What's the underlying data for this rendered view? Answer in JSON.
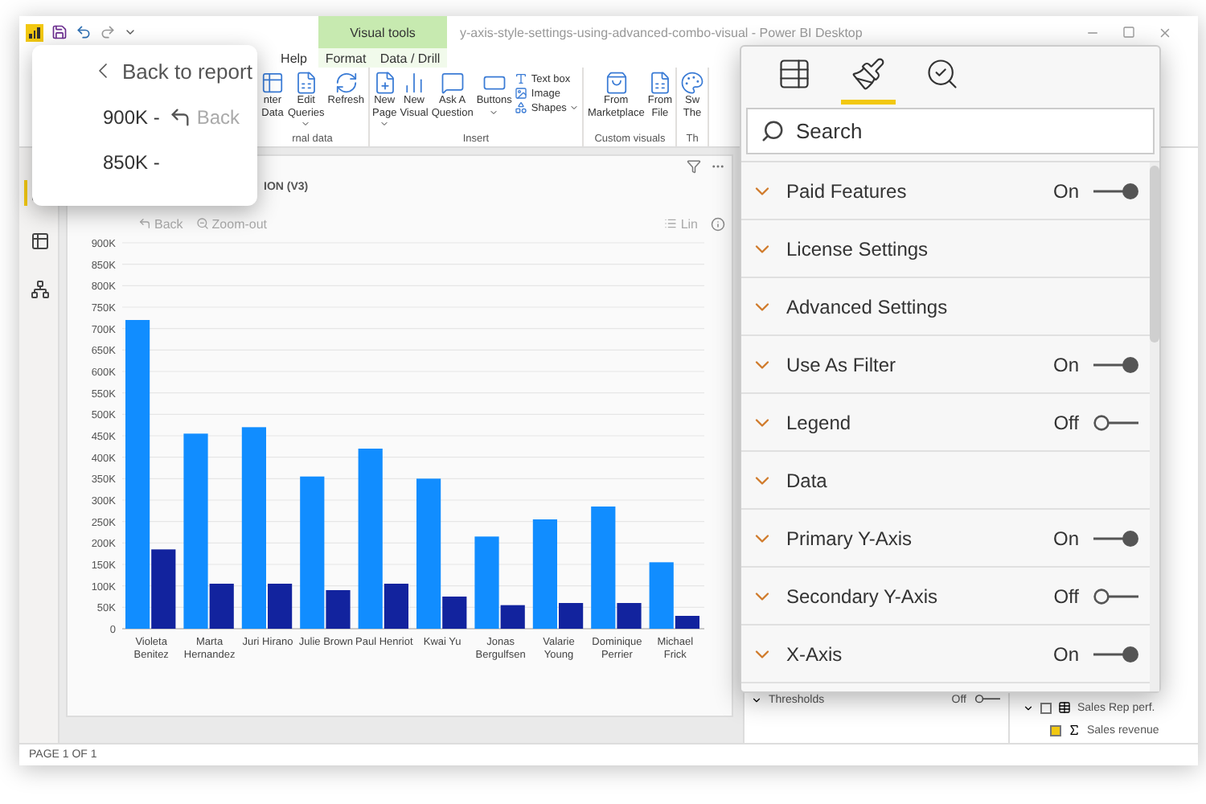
{
  "window": {
    "title": "y-axis-style-settings-using-advanced-combo-visual - Power BI Desktop",
    "contextual_tab": "Visual tools"
  },
  "ribbon_tabs": [
    "Help"
  ],
  "contextual_tabs": [
    "Format",
    "Data / Drill"
  ],
  "ribbon_groups": [
    {
      "label": "rnal data",
      "buttons": [
        {
          "kind": "large",
          "lines": [
            "nter",
            "Data"
          ],
          "dropdown": false
        },
        {
          "kind": "large",
          "lines": [
            "Edit",
            "Queries"
          ],
          "dropdown": true
        },
        {
          "kind": "large",
          "lines": [
            "Refresh"
          ],
          "dropdown": false
        }
      ]
    },
    {
      "label": "Insert",
      "buttons": [
        {
          "kind": "large",
          "lines": [
            "New",
            "Page"
          ],
          "dropdown": true
        },
        {
          "kind": "large",
          "lines": [
            "New",
            "Visual"
          ],
          "dropdown": false
        },
        {
          "kind": "large",
          "lines": [
            "Ask A",
            "Question"
          ],
          "dropdown": false
        },
        {
          "kind": "large",
          "lines": [
            "Buttons"
          ],
          "dropdown": true
        },
        {
          "kind": "small",
          "lines": [
            "Text box"
          ],
          "dropdown": false
        },
        {
          "kind": "small",
          "lines": [
            "Image"
          ],
          "dropdown": false
        },
        {
          "kind": "small",
          "lines": [
            "Shapes"
          ],
          "dropdown": true
        }
      ]
    },
    {
      "label": "Custom visuals",
      "buttons": [
        {
          "kind": "large",
          "lines": [
            "From",
            "Marketplace"
          ],
          "dropdown": false
        },
        {
          "kind": "large",
          "lines": [
            "From",
            "File"
          ],
          "dropdown": false
        }
      ]
    },
    {
      "label": "Th",
      "buttons": [
        {
          "kind": "large",
          "lines": [
            "Sw",
            "The"
          ],
          "dropdown": false
        }
      ]
    }
  ],
  "back_popup": {
    "back_link": "Back to report",
    "ticks": [
      "900K -",
      "850K -"
    ],
    "back_button": "Back"
  },
  "visual": {
    "title": "ION (V3)",
    "toolbar": [
      "Back",
      "Zoom-out"
    ],
    "scale_button": "Lin",
    "chart_data": {
      "type": "bar",
      "categories": [
        "Violeta Benitez",
        "Marta Hernandez",
        "Juri Hirano",
        "Julie Brown",
        "Paul Henriot",
        "Kwai Yu",
        "Jonas Bergulfsen",
        "Valarie Young",
        "Dominique Perrier",
        "Michael Frick"
      ],
      "series": [
        {
          "color": "#118dff",
          "values": [
            720000,
            455000,
            470000,
            355000,
            420000,
            350000,
            215000,
            255000,
            285000,
            155000
          ]
        },
        {
          "color": "#12239e",
          "values": [
            185000,
            105000,
            105000,
            90000,
            105000,
            75000,
            55000,
            60000,
            60000,
            30000
          ]
        }
      ],
      "ylim": [
        0,
        900000
      ],
      "grid": true,
      "yticks": [
        {
          "value": 0,
          "label": "0"
        },
        {
          "value": 50000,
          "label": "50K"
        },
        {
          "value": 100000,
          "label": "100K"
        },
        {
          "value": 150000,
          "label": "150K"
        },
        {
          "value": 200000,
          "label": "200K"
        },
        {
          "value": 250000,
          "label": "250K"
        },
        {
          "value": 300000,
          "label": "300K"
        },
        {
          "value": 350000,
          "label": "350K"
        },
        {
          "value": 400000,
          "label": "400K"
        },
        {
          "value": 450000,
          "label": "450K"
        },
        {
          "value": 500000,
          "label": "500K"
        },
        {
          "value": 550000,
          "label": "550K"
        },
        {
          "value": 600000,
          "label": "600K"
        },
        {
          "value": 650000,
          "label": "650K"
        },
        {
          "value": 700000,
          "label": "700K"
        },
        {
          "value": 750000,
          "label": "750K"
        },
        {
          "value": 800000,
          "label": "800K"
        },
        {
          "value": 850000,
          "label": "850K"
        },
        {
          "value": 900000,
          "label": "900K"
        }
      ]
    }
  },
  "thresholds": {
    "label": "Thresholds",
    "state_label": "Off",
    "on": false
  },
  "fields": [
    {
      "label": "Sales Rep perf.",
      "checked": false,
      "expanded": true,
      "children": [
        {
          "label": "Sales revenue",
          "checked": true
        }
      ]
    }
  ],
  "status_bar": "PAGE 1 OF 1",
  "format_pane": {
    "tabs": [
      {
        "selected": false
      },
      {
        "selected": true
      },
      {
        "selected": false
      }
    ],
    "search_placeholder": "Search",
    "sections": [
      {
        "kind": "toggle",
        "label": "Paid Features",
        "state_label": "On",
        "on": true
      },
      {
        "kind": "plain",
        "label": "License Settings"
      },
      {
        "kind": "plain",
        "label": "Advanced Settings"
      },
      {
        "kind": "toggle",
        "label": "Use As Filter",
        "state_label": "On",
        "on": true
      },
      {
        "kind": "toggle",
        "label": "Legend",
        "state_label": "Off",
        "on": false
      },
      {
        "kind": "plain",
        "label": "Data"
      },
      {
        "kind": "toggle",
        "label": "Primary Y-Axis",
        "state_label": "On",
        "on": true
      },
      {
        "kind": "toggle",
        "label": "Secondary Y-Axis",
        "state_label": "Off",
        "on": false
      },
      {
        "kind": "toggle",
        "label": "X-Axis",
        "state_label": "On",
        "on": true
      }
    ]
  }
}
